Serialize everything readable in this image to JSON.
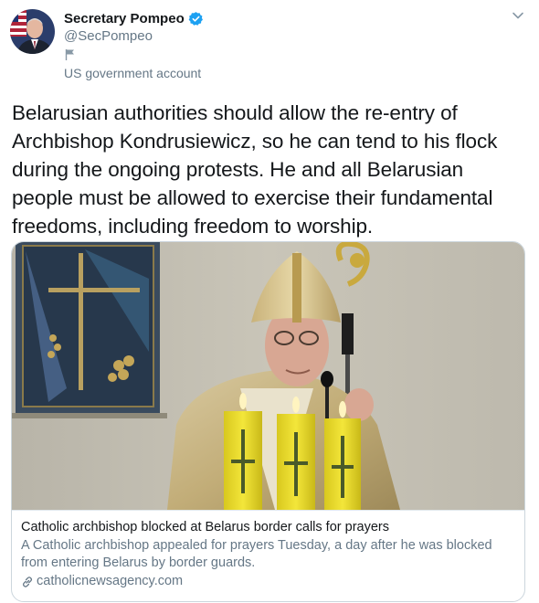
{
  "user": {
    "name": "Secretary Pompeo",
    "handle": "@SecPompeo",
    "label": "US government account",
    "verified": true
  },
  "icons": {
    "avatar": "avatar-photo",
    "verified": "verified-badge-icon",
    "caret": "chevron-down-icon",
    "flag": "flag-icon",
    "link": "link-icon"
  },
  "tweet": {
    "text": "Belarusian authorities should allow the re-entry of Archbishop Kondrusiewicz, so he can tend to his flock during the ongoing protests. He and all Belarusian people must be allowed to exercise their fundamental freedoms, including freedom to worship."
  },
  "card": {
    "title": "Catholic archbishop blocked at Belarus border calls for prayers",
    "description": "A Catholic archbishop appealed for prayers Tuesday, a day after he was blocked from entering Belarus by border guards.",
    "domain": "catholicnewsagency.com"
  },
  "colors": {
    "primary_text": "#14171a",
    "secondary_text": "#657786",
    "verified_blue": "#1da1f2",
    "border": "#ccd6dd"
  }
}
